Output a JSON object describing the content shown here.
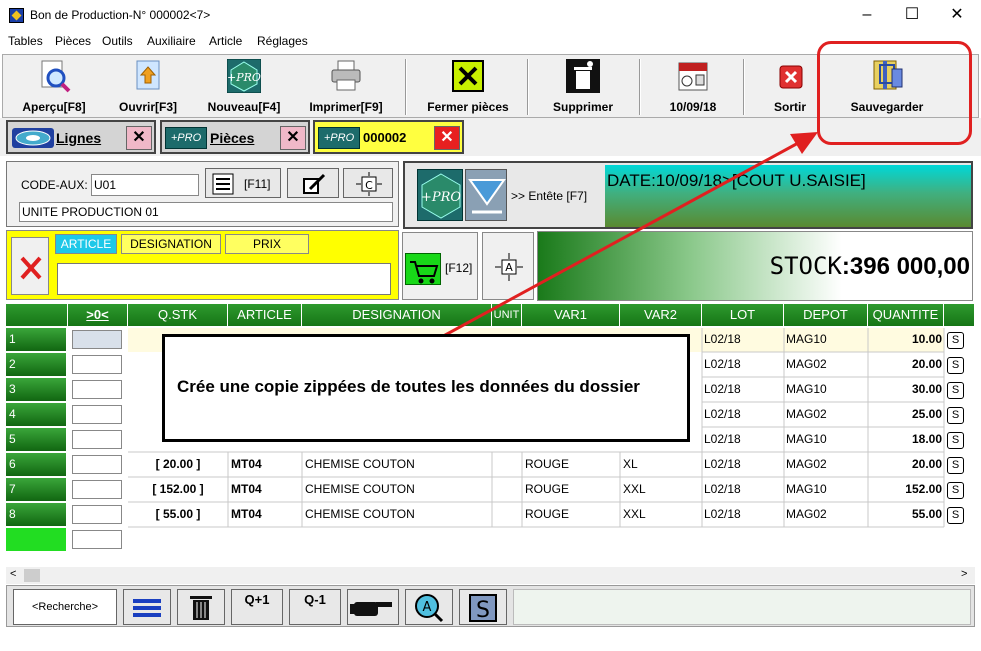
{
  "window": {
    "title": "Bon de Production-N° 000002<7>",
    "minimize": "–",
    "maximize": "☐",
    "close": "✕"
  },
  "menu": [
    "Tables",
    "Pièces",
    "Outils",
    "Auxiliaire",
    "Article",
    "Réglages"
  ],
  "toolbar": [
    {
      "label": "Aperçu[F8]",
      "icon": "preview-magnifier-icon"
    },
    {
      "label": "Ouvrir[F3]",
      "icon": "open-file-icon"
    },
    {
      "label": "Nouveau[F4]",
      "icon": "pro-new-icon",
      "icon_text": "+PRO"
    },
    {
      "label": "Imprimer[F9]",
      "icon": "printer-icon"
    },
    {
      "label": "Fermer pièces",
      "icon": "close-x-icon"
    },
    {
      "label": "Supprimer",
      "icon": "trash-icon"
    },
    {
      "label": "10/09/18",
      "icon": "calendar-icon"
    },
    {
      "label": "Sortir",
      "icon": "exit-icon"
    },
    {
      "label": "Sauvegarder",
      "icon": "zip-backup-icon"
    }
  ],
  "tabs": [
    {
      "label": "Lignes",
      "close": "✕"
    },
    {
      "label": "Pièces",
      "icon_text": "+PRO",
      "close": "✕"
    },
    {
      "label": "000002",
      "icon_text": "+PRO",
      "close": "✕"
    }
  ],
  "header": {
    "code_label": "CODE-AUX:",
    "code_value": "U01",
    "name_value": "UNITE PRODUCTION 01",
    "f11": "[F11]",
    "entete": ">> Entête [F7]",
    "pro_text": "+PRO",
    "date_text": "DATE:10/09/18>[COUT U.SAISIE]"
  },
  "article_panel": {
    "cols": [
      "ARTICLE",
      "DESIGNATION",
      "PRIX"
    ],
    "f12": "[F12]",
    "stock_label": "STOCK",
    "stock_sep": ":",
    "stock_value": "396 000,00"
  },
  "grid": {
    "headers": [
      ">0<",
      "Q.STK",
      "ARTICLE",
      "DESIGNATION",
      "UNIT",
      "VAR1",
      "VAR2",
      "LOT",
      "DEPOT",
      "QUANTITE"
    ],
    "rows": [
      {
        "n": "1",
        "qstk": "",
        "article": "",
        "designation": "",
        "var1": "",
        "var2": "",
        "lot": "L02/18",
        "depot": "MAG10",
        "qte": "10.00"
      },
      {
        "n": "2",
        "qstk": "",
        "article": "",
        "designation": "",
        "var1": "",
        "var2": "",
        "lot": "L02/18",
        "depot": "MAG02",
        "qte": "20.00"
      },
      {
        "n": "3",
        "qstk": "",
        "article": "",
        "designation": "",
        "var1": "",
        "var2": "",
        "lot": "L02/18",
        "depot": "MAG10",
        "qte": "30.00"
      },
      {
        "n": "4",
        "qstk": "",
        "article": "",
        "designation": "",
        "var1": "",
        "var2": "",
        "lot": "L02/18",
        "depot": "MAG02",
        "qte": "25.00"
      },
      {
        "n": "5",
        "qstk": "",
        "article": "",
        "designation": "",
        "var1": "",
        "var2": "",
        "lot": "L02/18",
        "depot": "MAG10",
        "qte": "18.00"
      },
      {
        "n": "6",
        "qstk": "[ 20.00 ]",
        "article": "MT04",
        "designation": "CHEMISE COUTON",
        "var1": "ROUGE",
        "var2": "XL",
        "lot": "L02/18",
        "depot": "MAG02",
        "qte": "20.00"
      },
      {
        "n": "7",
        "qstk": "[ 152.00 ]",
        "article": "MT04",
        "designation": "CHEMISE COUTON",
        "var1": "ROUGE",
        "var2": "XXL",
        "lot": "L02/18",
        "depot": "MAG10",
        "qte": "152.00"
      },
      {
        "n": "8",
        "qstk": "[ 55.00 ]",
        "article": "MT04",
        "designation": "CHEMISE COUTON",
        "var1": "ROUGE",
        "var2": "XXL",
        "lot": "L02/18",
        "depot": "MAG02",
        "qte": "55.00"
      }
    ],
    "s_label": "S"
  },
  "bottom": {
    "search": "<Recherche>",
    "qplus": "Q+1",
    "qminus": "Q-1",
    "a_label": "A",
    "s_label": "S"
  },
  "annotation": {
    "text": "Crée une copie zippées de toutes les données du dossier",
    "color": "#e02020"
  }
}
